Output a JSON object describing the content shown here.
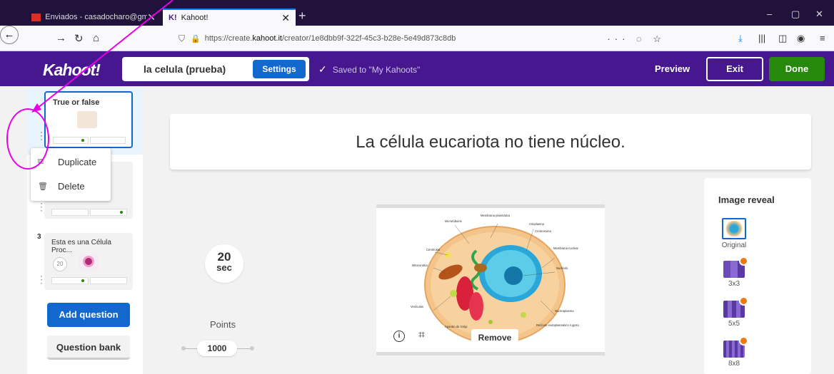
{
  "browser": {
    "tabs": [
      {
        "label": "Enviados - casadocharo@gma",
        "active": false
      },
      {
        "label": "Kahoot!",
        "active": true
      }
    ],
    "url_prefix": "https://create.",
    "url_domain": "kahoot.it",
    "url_suffix": "/creator/1e8dbb9f-322f-45c3-b28e-5e49d873c8db",
    "new_tab": "+",
    "window_controls": [
      "–",
      "▢",
      "✕"
    ]
  },
  "header": {
    "logo": "Kahoot!",
    "title": "la celula (prueba)",
    "settings_label": "Settings",
    "saved_text": "Saved to \"My Kahoots\"",
    "preview_label": "Preview",
    "exit_label": "Exit",
    "done_label": "Done"
  },
  "sidebar": {
    "slides": [
      {
        "number": "",
        "title": "True or false",
        "time": "",
        "selected": true
      },
      {
        "number": "",
        "title": "",
        "time": "",
        "selected": false
      },
      {
        "number": "3",
        "title": "Esta es una Célula Proc...",
        "time": "20",
        "selected": false
      }
    ],
    "add_question_label": "Add question",
    "question_bank_label": "Question bank"
  },
  "context_menu": {
    "items": [
      {
        "label": "Duplicate",
        "icon": "duplicate-icon"
      },
      {
        "label": "Delete",
        "icon": "trash-icon"
      }
    ]
  },
  "question": {
    "text": "La célula eucariota no tiene núcleo.",
    "time_value": "20",
    "time_unit": "sec",
    "points_label": "Points",
    "points_value": "1000"
  },
  "media": {
    "remove_label": "Remove",
    "diagram_labels": [
      "Microtúbulos",
      "Membrana plasmática",
      "Citoplasma",
      "Cromosoma",
      "Centríolos",
      "Membrana nuclear",
      "Mitocondria",
      "Nucléolo",
      "Vesículas",
      "Nucleoplasma",
      "Aparato de Golgi",
      "Retículo endoplasmático rugoso"
    ]
  },
  "image_reveal": {
    "title": "Image reveal",
    "options": [
      {
        "label": "Original",
        "selected": true
      },
      {
        "label": "3x3",
        "selected": false
      },
      {
        "label": "5x5",
        "selected": false
      },
      {
        "label": "8x8",
        "selected": false
      }
    ]
  },
  "colors": {
    "brand_purple": "#46178f",
    "primary_blue": "#1368ce",
    "done_green": "#26890c",
    "annotation_magenta": "#e800e8"
  }
}
